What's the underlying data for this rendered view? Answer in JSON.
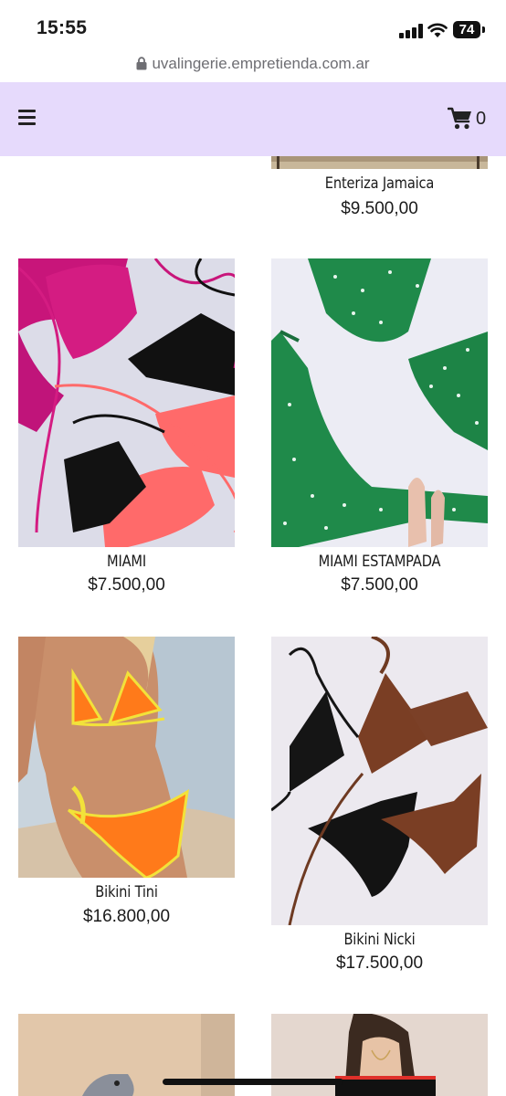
{
  "status_bar": {
    "time": "15:55",
    "battery": "74"
  },
  "browser": {
    "url": "uvalingerie.empretienda.com.ar"
  },
  "header": {
    "cart_count": "0"
  },
  "products": [
    {
      "name": "Enteriza Jamaica",
      "price": "$9.500,00"
    },
    {
      "name": "MIAMI",
      "price": "$7.500,00"
    },
    {
      "name": "MIAMI ESTAMPADA",
      "price": "$7.500,00"
    },
    {
      "name": "Bikini Tini",
      "price": "$16.800,00"
    },
    {
      "name": "Bikini Nicki",
      "price": "$17.500,00"
    }
  ],
  "icons": {
    "lock": "lock-icon",
    "menu": "hamburger-menu-icon",
    "cart": "shopping-cart-icon",
    "signal": "cellular-signal-icon",
    "wifi": "wifi-icon",
    "battery": "battery-icon"
  }
}
